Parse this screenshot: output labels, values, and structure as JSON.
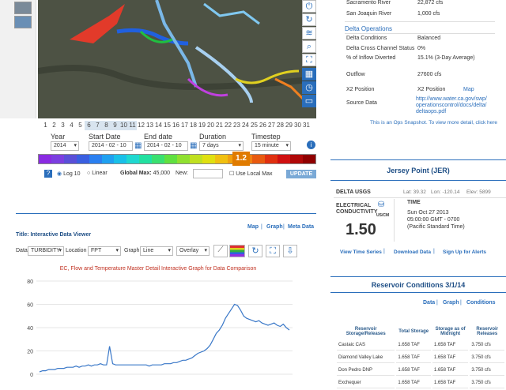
{
  "top_right": {
    "rows": [
      {
        "label": "Sacramento River",
        "value": "22,872 cfs"
      },
      {
        "label": "San Joaquin River",
        "value": "1,000 cfs"
      }
    ],
    "section_title": "Delta Operations",
    "ops_rows": [
      {
        "label": "Delta Conditions",
        "value": "Balanced"
      },
      {
        "label": "Delta Cross Channel Status",
        "value": "0%"
      },
      {
        "label": "% of Inflow Diverted",
        "value": "15.1% (3-Day Average)"
      },
      {
        "label": "Outflow",
        "value": "27600 cfs"
      },
      {
        "label": "X2 Position",
        "value": "X2 Position",
        "link": "Map"
      },
      {
        "label": "Source Data",
        "value": "http://www.water.ca.gov/swp/operationscontrol/docs/delta/deltaops.pdf"
      }
    ],
    "snapshot_note": "This is an Ops Snapshot. To view more detail, click here"
  },
  "pager": [
    "1",
    "2",
    "3",
    "4",
    "5",
    "6",
    "7",
    "8",
    "9",
    "10",
    "11",
    "12",
    "13",
    "14",
    "15",
    "16",
    "17",
    "18",
    "19",
    "20",
    "21",
    "22",
    "23",
    "24",
    "25",
    "26",
    "27",
    "28",
    "29",
    "30",
    "31"
  ],
  "controls": {
    "year_label": "Year",
    "year_value": "2014",
    "start_label": "Start Date",
    "start_value": "2014 - 02 - 10",
    "end_label": "End date",
    "end_value": "2014 - 02 - 10",
    "duration_label": "Duration",
    "duration_value": "7 days",
    "timestep_label": "Timestep",
    "timestep_value": "15 minute"
  },
  "colorbar": {
    "marker": "1.2",
    "colors": [
      "#8a2be2",
      "#7b3fe0",
      "#5a4fd8",
      "#3a5fe0",
      "#2a7ff0",
      "#1fa0f0",
      "#19c0e8",
      "#1fd8d0",
      "#22e0a0",
      "#3ae070",
      "#60e040",
      "#90e030",
      "#c0e020",
      "#e0e010",
      "#f0c010",
      "#f0a010",
      "#f08010",
      "#e85a10",
      "#e03010",
      "#d01010",
      "#b00808",
      "#900000"
    ]
  },
  "options": {
    "log_label": "Log 10",
    "linear_label": "Linear",
    "global_max_label": "Global Max:",
    "global_max_value": "45,000",
    "new_label": "New:",
    "local_max_label": "Use Local Max",
    "update_label": "UPDATE",
    "help_label": "?"
  },
  "station": {
    "title": "Jersey Point (JER)",
    "agency": "DELTA  USGS",
    "lat": "Lat: 39.32",
    "lon": "Lon: -120.14",
    "elev": "Elev: 5899",
    "param_label": "ELECTRICAL CONDUCTIVITY",
    "unit": "US/CM",
    "value": "1.50",
    "time_label": "TIME",
    "time_lines": [
      "Sun  Oct 27 2013",
      "05:00:00 GMT - 0700",
      "(Pacific Standard Time)"
    ],
    "links": [
      "View Time Series",
      "Download Data",
      "Sign Up for Alerts"
    ]
  },
  "viewer": {
    "tabs": [
      "Map",
      "Graph",
      "Meta Data"
    ],
    "title": "Title: Interactive Data Viewer",
    "data_label": "Data",
    "data_value": "TURBIDITY",
    "location_label": "Location",
    "location_value": "FPT",
    "graph_label": "Graph",
    "graph_value": "Line",
    "overlay_value": "Overlay"
  },
  "chart_data": {
    "type": "line",
    "title": "EC, Flow and Temperature Master Detail Interactive Graph for Data Comparison",
    "ylim": [
      0,
      80
    ],
    "yticks": [
      0,
      20,
      40,
      60,
      80
    ],
    "series": [
      {
        "color": "#3a78c8",
        "values": [
          2,
          3,
          3,
          4,
          4,
          4,
          5,
          5,
          5,
          6,
          6,
          6,
          7,
          6,
          7,
          7,
          8,
          7,
          8,
          8,
          9,
          8,
          8,
          24,
          9,
          8,
          8,
          8,
          8,
          8,
          8,
          8,
          8,
          8,
          8,
          8,
          7,
          8,
          8,
          8,
          8,
          9,
          9,
          9,
          10,
          10,
          11,
          12,
          12,
          13,
          14,
          16,
          18,
          19,
          20,
          22,
          25,
          30,
          35,
          38,
          42,
          48,
          52,
          56,
          60,
          59,
          55,
          50,
          48,
          47,
          46,
          45,
          46,
          44,
          43,
          42,
          43,
          44,
          42,
          41,
          43,
          40,
          38
        ]
      }
    ]
  },
  "reservoir": {
    "title": "Reservoir Conditions 3/1/14",
    "tabs": [
      "Data",
      "Graph",
      "Conditions"
    ],
    "headers": [
      "Reservoir Storage/Releases",
      "Total Storage",
      "Storage as of Midnight",
      "Reservoir Releases"
    ],
    "rows": [
      [
        "Castaic  CAS",
        "1.658 TAF",
        "1.658 TAF",
        "3.750 cfs"
      ],
      [
        "Diamond Valley Lake",
        "1.658 TAF",
        "1.658 TAF",
        "3.750 cfs"
      ],
      [
        "Don Pedro  DNP",
        "1.658 TAF",
        "1.658 TAF",
        "3.750 cfs"
      ],
      [
        "Exchequer",
        "1.658 TAF",
        "1.658 TAF",
        "3.750 cfs"
      ]
    ]
  }
}
